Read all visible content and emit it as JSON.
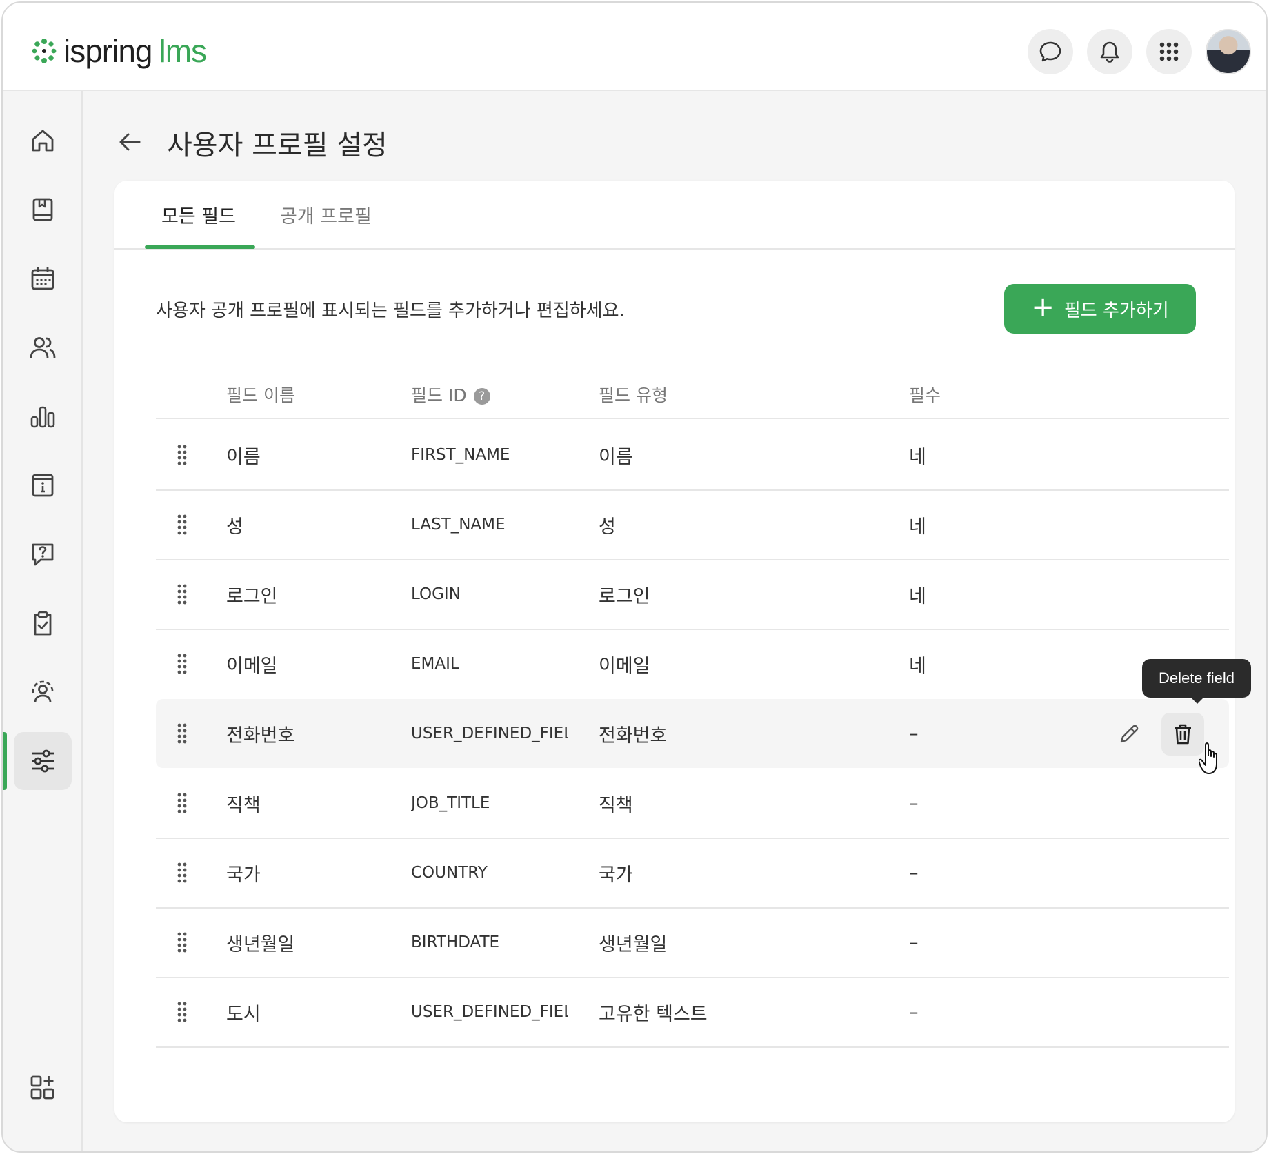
{
  "header": {
    "logo_text": "ispring",
    "logo_suffix": "lms",
    "icons": [
      "chat-icon",
      "bell-icon",
      "apps-grid-icon"
    ]
  },
  "sidebar": {
    "items": [
      {
        "icon": "home-icon"
      },
      {
        "icon": "book-icon"
      },
      {
        "icon": "calendar-icon"
      },
      {
        "icon": "users-icon"
      },
      {
        "icon": "chart-icon"
      },
      {
        "icon": "info-icon"
      },
      {
        "icon": "question-icon"
      },
      {
        "icon": "clipboard-check-icon"
      },
      {
        "icon": "user-target-icon"
      },
      {
        "icon": "sliders-icon",
        "active": true
      }
    ],
    "bottom_icon": "add-widget-icon"
  },
  "page": {
    "title": "사용자 프로필 설정"
  },
  "tabs": [
    {
      "label": "모든 필드",
      "active": true
    },
    {
      "label": "공개 프로필",
      "active": false
    }
  ],
  "description": "사용자 공개 프로필에 표시되는 필드를 추가하거나 편집하세요.",
  "add_button": {
    "label": "필드 추가하기",
    "icon": "+"
  },
  "table": {
    "headers": {
      "name": "필드 이름",
      "id": "필드 ID",
      "type": "필드 유형",
      "required": "필수"
    },
    "help_glyph": "?",
    "rows": [
      {
        "name": "이름",
        "id": "FIRST_NAME",
        "type": "이름",
        "required": "네"
      },
      {
        "name": "성",
        "id": "LAST_NAME",
        "type": "성",
        "required": "네"
      },
      {
        "name": "로그인",
        "id": "LOGIN",
        "type": "로그인",
        "required": "네"
      },
      {
        "name": "이메일",
        "id": "EMAIL",
        "type": "이메일",
        "required": "네"
      },
      {
        "name": "전화번호",
        "id": "USER_DEFINED_FIEL",
        "type": "전화번호",
        "required": "–"
      },
      {
        "name": "직책",
        "id": "JOB_TITLE",
        "type": "직책",
        "required": "–"
      },
      {
        "name": "국가",
        "id": "COUNTRY",
        "type": "국가",
        "required": "–"
      },
      {
        "name": "생년월일",
        "id": "BIRTHDATE",
        "type": "생년월일",
        "required": "–"
      },
      {
        "name": "도시",
        "id": "USER_DEFINED_FIEL",
        "type": "고유한 텍스트",
        "required": "–"
      }
    ]
  },
  "tooltip": {
    "text": "Delete field"
  },
  "colors": {
    "accent": "#3aa757",
    "tooltip_bg": "#2b2b2b"
  }
}
